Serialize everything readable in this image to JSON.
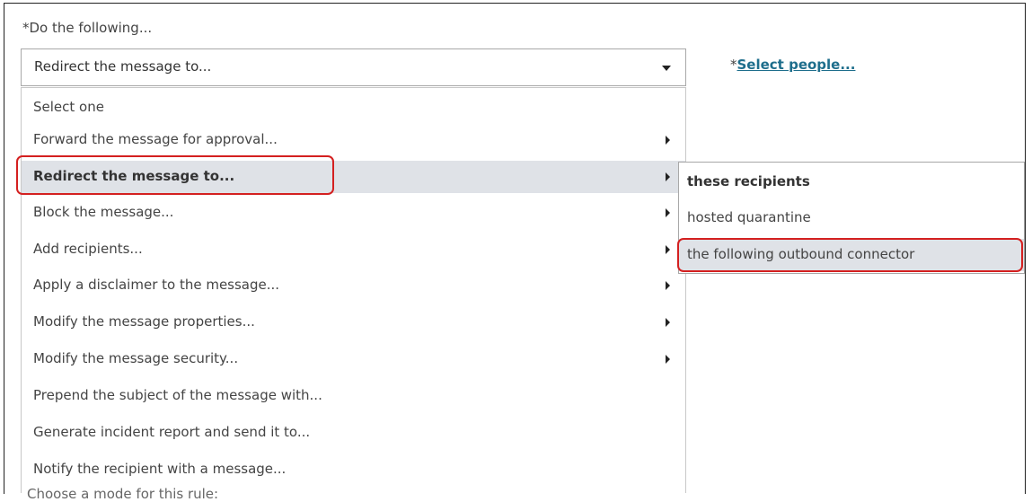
{
  "field_label": "*Do the following...",
  "select": {
    "value": "Redirect the message to..."
  },
  "select_people": {
    "star": "*",
    "label": "Select people..."
  },
  "menu": {
    "items": [
      {
        "label": "Select one",
        "has_submenu": false
      },
      {
        "label": "Forward the message for approval...",
        "has_submenu": true
      },
      {
        "label": "Redirect the message to...",
        "has_submenu": true,
        "highlighted": true
      },
      {
        "label": "Block the message...",
        "has_submenu": true
      },
      {
        "label": "Add recipients...",
        "has_submenu": true
      },
      {
        "label": "Apply a disclaimer to the message...",
        "has_submenu": true
      },
      {
        "label": "Modify the message properties...",
        "has_submenu": true
      },
      {
        "label": "Modify the message security...",
        "has_submenu": true
      },
      {
        "label": "Prepend the subject of the message with...",
        "has_submenu": false
      },
      {
        "label": "Generate incident report and send it to...",
        "has_submenu": false
      },
      {
        "label": "Notify the recipient with a message...",
        "has_submenu": false
      }
    ]
  },
  "submenu": {
    "items": [
      {
        "label": "these recipients",
        "bold": true
      },
      {
        "label": "hosted quarantine",
        "bold": false
      },
      {
        "label": "the following outbound connector",
        "bold": false,
        "hover": true
      }
    ]
  },
  "cutoff_text": "Choose a mode for this rule:",
  "colors": {
    "highlight_bg": "#dfe2e7",
    "callout_red": "#d42020",
    "link": "#1e6e8c"
  }
}
